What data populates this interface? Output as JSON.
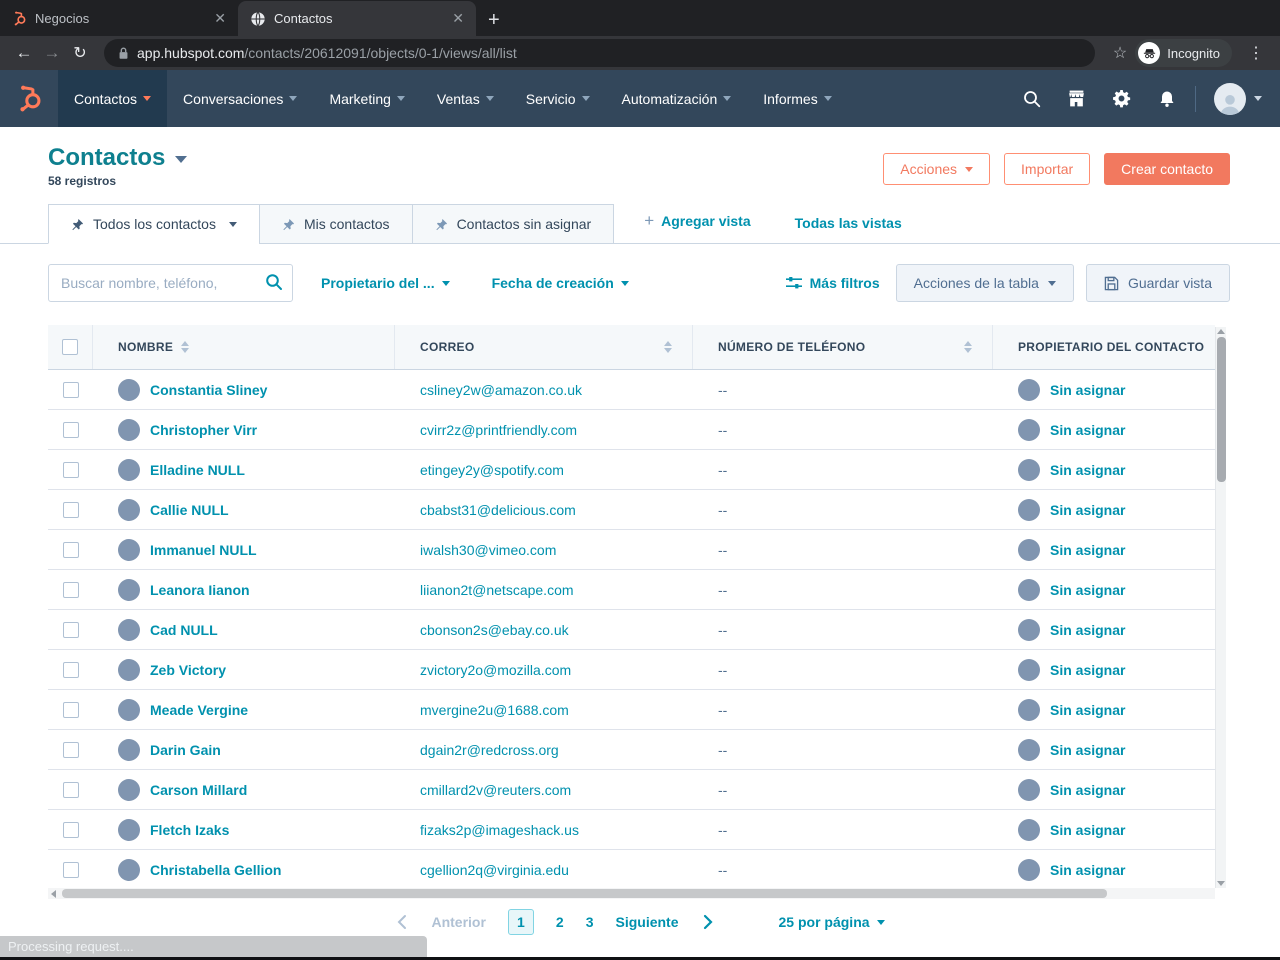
{
  "browser": {
    "tabs": [
      {
        "title": "Negocios",
        "favicon": "hubspot-sprocket-icon"
      },
      {
        "title": "Contactos",
        "favicon": "globe-icon",
        "active": true
      }
    ],
    "url_host": "app.hubspot.com",
    "url_path": "/contacts/20612091/objects/0-1/views/all/list",
    "incognito_label": "Incognito",
    "status_text": "Processing request...."
  },
  "nav": {
    "items": [
      {
        "label": "Contactos",
        "active": true
      },
      {
        "label": "Conversaciones"
      },
      {
        "label": "Marketing"
      },
      {
        "label": "Ventas"
      },
      {
        "label": "Servicio"
      },
      {
        "label": "Automatización"
      },
      {
        "label": "Informes"
      }
    ]
  },
  "header": {
    "title": "Contactos",
    "record_count": "58 registros",
    "actions_button": "Acciones",
    "import_button": "Importar",
    "create_button": "Crear contacto"
  },
  "views": {
    "tabs": [
      {
        "label": "Todos los contactos",
        "active": true
      },
      {
        "label": "Mis contactos"
      },
      {
        "label": "Contactos sin asignar"
      }
    ],
    "add_view": "Agregar vista",
    "all_views": "Todas las vistas"
  },
  "filters": {
    "search_placeholder": "Buscar nombre, teléfono,",
    "owner_filter": "Propietario del ...",
    "date_filter": "Fecha de creación",
    "more_filters": "Más filtros",
    "table_actions": "Acciones de la tabla",
    "save_view": "Guardar vista"
  },
  "table": {
    "columns": [
      "NOMBRE",
      "CORREO",
      "NÚMERO DE TELÉFONO",
      "PROPIETARIO DEL CONTACTO"
    ],
    "rows": [
      {
        "name": "Constantia Sliney",
        "email": "csliney2w@amazon.co.uk",
        "phone": "--",
        "owner": "Sin asignar"
      },
      {
        "name": "Christopher Virr",
        "email": "cvirr2z@printfriendly.com",
        "phone": "--",
        "owner": "Sin asignar"
      },
      {
        "name": "Elladine NULL",
        "email": "etingey2y@spotify.com",
        "phone": "--",
        "owner": "Sin asignar"
      },
      {
        "name": "Callie NULL",
        "email": "cbabst31@delicious.com",
        "phone": "--",
        "owner": "Sin asignar"
      },
      {
        "name": "Immanuel NULL",
        "email": "iwalsh30@vimeo.com",
        "phone": "--",
        "owner": "Sin asignar"
      },
      {
        "name": "Leanora Iianon",
        "email": "liianon2t@netscape.com",
        "phone": "--",
        "owner": "Sin asignar"
      },
      {
        "name": "Cad NULL",
        "email": "cbonson2s@ebay.co.uk",
        "phone": "--",
        "owner": "Sin asignar"
      },
      {
        "name": "Zeb Victory",
        "email": "zvictory2o@mozilla.com",
        "phone": "--",
        "owner": "Sin asignar"
      },
      {
        "name": "Meade Vergine",
        "email": "mvergine2u@1688.com",
        "phone": "--",
        "owner": "Sin asignar"
      },
      {
        "name": "Darin Gain",
        "email": "dgain2r@redcross.org",
        "phone": "--",
        "owner": "Sin asignar"
      },
      {
        "name": "Carson Millard",
        "email": "cmillard2v@reuters.com",
        "phone": "--",
        "owner": "Sin asignar"
      },
      {
        "name": "Fletch Izaks",
        "email": "fizaks2p@imageshack.us",
        "phone": "--",
        "owner": "Sin asignar"
      },
      {
        "name": "Christabella Gellion",
        "email": "cgellion2q@virginia.edu",
        "phone": "--",
        "owner": "Sin asignar"
      }
    ]
  },
  "pagination": {
    "prev_label": "Anterior",
    "pages": [
      "1",
      "2",
      "3"
    ],
    "current_page": "1",
    "next_label": "Siguiente",
    "per_page": "25 por página"
  },
  "colors": {
    "brand_orange": "#f2795f",
    "link_teal": "#0091ae",
    "nav_bg": "#33475b",
    "heading_teal": "#0e808f"
  }
}
